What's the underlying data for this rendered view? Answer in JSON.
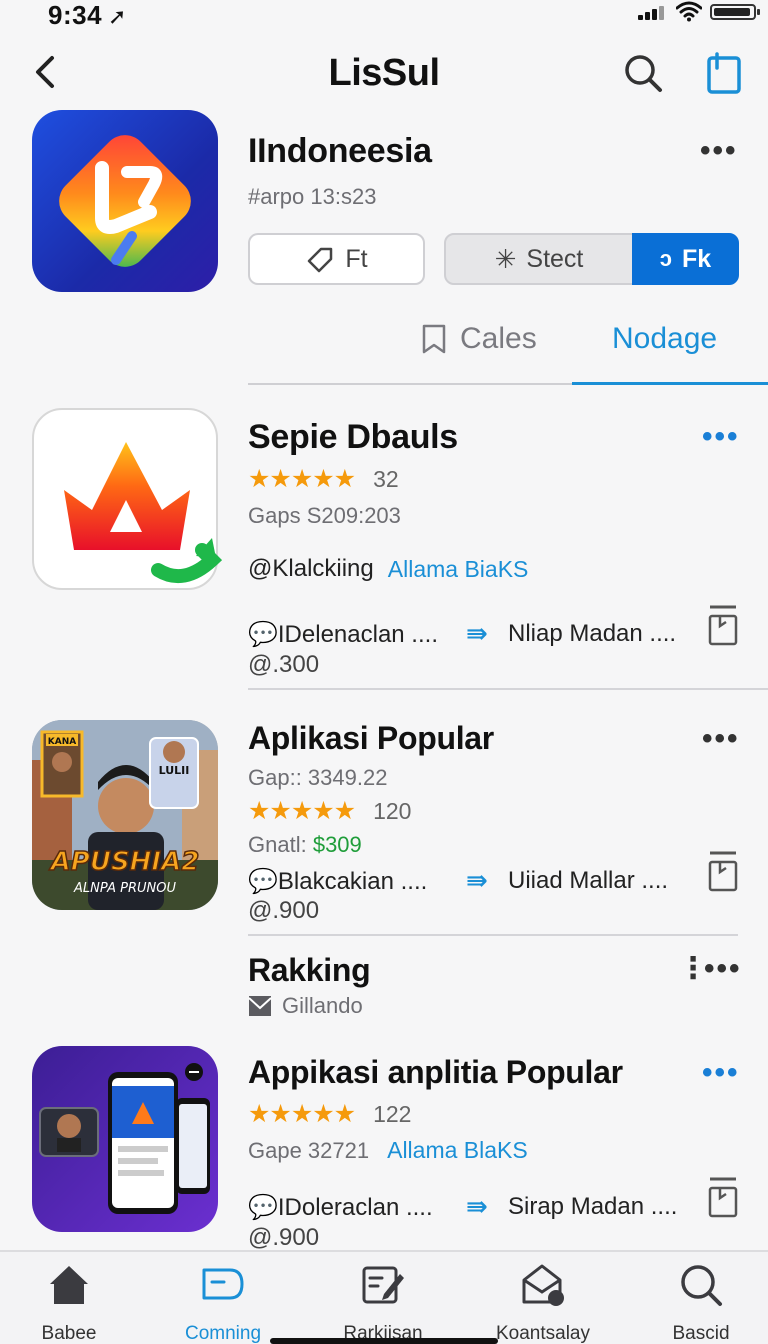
{
  "status": {
    "time": "9:34"
  },
  "header": {
    "title": "LisSul"
  },
  "featured": {
    "title": "IIndoneesia",
    "subtitle": "#arpo 13:s23",
    "buttons": {
      "left": "Ft",
      "middle": "Stect",
      "right": "Fk"
    },
    "tabs": {
      "first": "Cales",
      "second": "Nodage"
    }
  },
  "apps": [
    {
      "title": "Sepie Dbauls",
      "rating_count": "32",
      "price_line": "Gaps S209:203",
      "tag": "Klalckiing",
      "tag_link": "Allama BiaKS",
      "action_left": "IDelenaclan ....",
      "action_right": "Nliap Madan ....",
      "count": "300"
    },
    {
      "title": "Aplikasi Popular",
      "price_line": "Gap:: 3349.22",
      "rating_count": "120",
      "price_label": "Gnatl:",
      "price_value": "$309",
      "action_left": "Blakcakian ....",
      "action_right": "Uiiad Mallar ....",
      "count": "900",
      "icon_text_main": "APUSHIA2",
      "icon_text_sub": "ALNPA PRUNOU",
      "icon_badge_left": "KANA",
      "icon_badge_right": "LULII"
    },
    {
      "title": "Appikasi anplitia Popular",
      "rating_count": "122",
      "price_line": "Gape 32721",
      "tag_link": "Allama BlaKS",
      "action_left": "IDoleraclan ....",
      "action_right": "Sirap Madan ....",
      "count": "900"
    }
  ],
  "ranking": {
    "title": "Rakking",
    "subtitle": "Gillando"
  },
  "tabbar": {
    "items": [
      {
        "label": "Babee"
      },
      {
        "label": "Comning"
      },
      {
        "label": "Rarkiisan"
      },
      {
        "label": "Koantsalay"
      },
      {
        "label": "Bascid"
      }
    ]
  },
  "colors": {
    "accent": "#1a8fd6",
    "star": "#f59a0c",
    "button_blue": "#0a6fd6"
  },
  "icons": [
    "back-arrow",
    "search",
    "bookmark",
    "more",
    "star",
    "chat",
    "arrow-right",
    "home",
    "comment",
    "edit",
    "mail",
    "search"
  ]
}
